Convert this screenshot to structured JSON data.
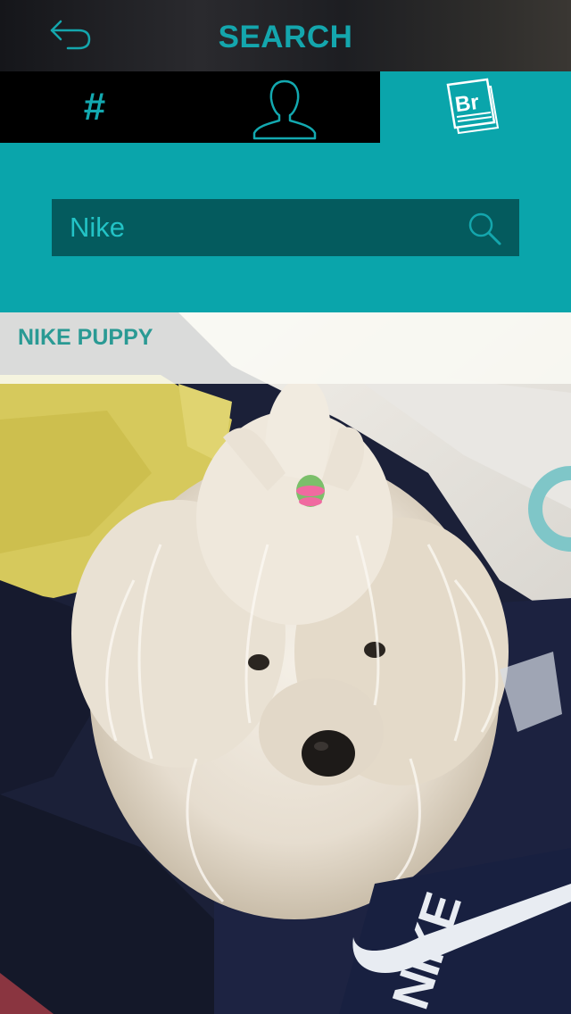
{
  "header": {
    "title": "SEARCH",
    "back_icon": "back-arrow-icon"
  },
  "tabs": [
    {
      "id": "hashtag",
      "label": "#",
      "icon": "hashtag-icon",
      "selected": false
    },
    {
      "id": "people",
      "icon": "person-icon",
      "selected": false
    },
    {
      "id": "brands",
      "icon": "brand-br-icon",
      "icon_text": "Br",
      "selected": true
    }
  ],
  "search": {
    "value": "Nike",
    "icon": "search-icon"
  },
  "results": [
    {
      "title": "NIKE PUPPY",
      "logo_text": "NIKE"
    }
  ],
  "colors": {
    "accent": "#0aa5ab",
    "accent_dark": "#045b5e",
    "accent_text": "#14a6ad",
    "tab_bar": "#000000",
    "caption_text": "#2a9a94"
  }
}
